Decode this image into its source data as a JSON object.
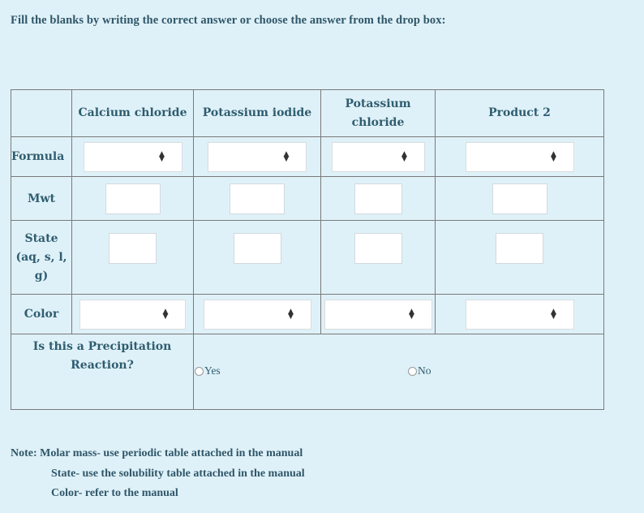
{
  "instruction": "Fill the blanks by writing the correct answer or choose the answer from the drop box:",
  "table": {
    "columns": [
      "Calcium chloride",
      "Potassium iodide",
      "Potassium chloride",
      "Product 2"
    ],
    "rows": {
      "formula": "Formula",
      "mwt": "Mwt",
      "state_line1": "State",
      "state_line2": "(aq, s, l,",
      "state_line3": "g)",
      "color": "Color"
    },
    "formula_values": [
      "",
      "",
      "",
      ""
    ],
    "mwt_values": [
      "",
      "",
      "",
      ""
    ],
    "state_values": [
      "",
      "",
      "",
      ""
    ],
    "color_values": [
      "",
      "",
      "",
      ""
    ],
    "precipitation": {
      "question_line1": "Is this a Precipitation",
      "question_line2": "Reaction?",
      "options": [
        "Yes",
        "No"
      ],
      "selected": null
    }
  },
  "note": {
    "line1": "Note: Molar mass- use periodic table attached in the manual",
    "line2": "State- use the solubility table attached in the manual",
    "line3": "Color- refer to the manual"
  }
}
